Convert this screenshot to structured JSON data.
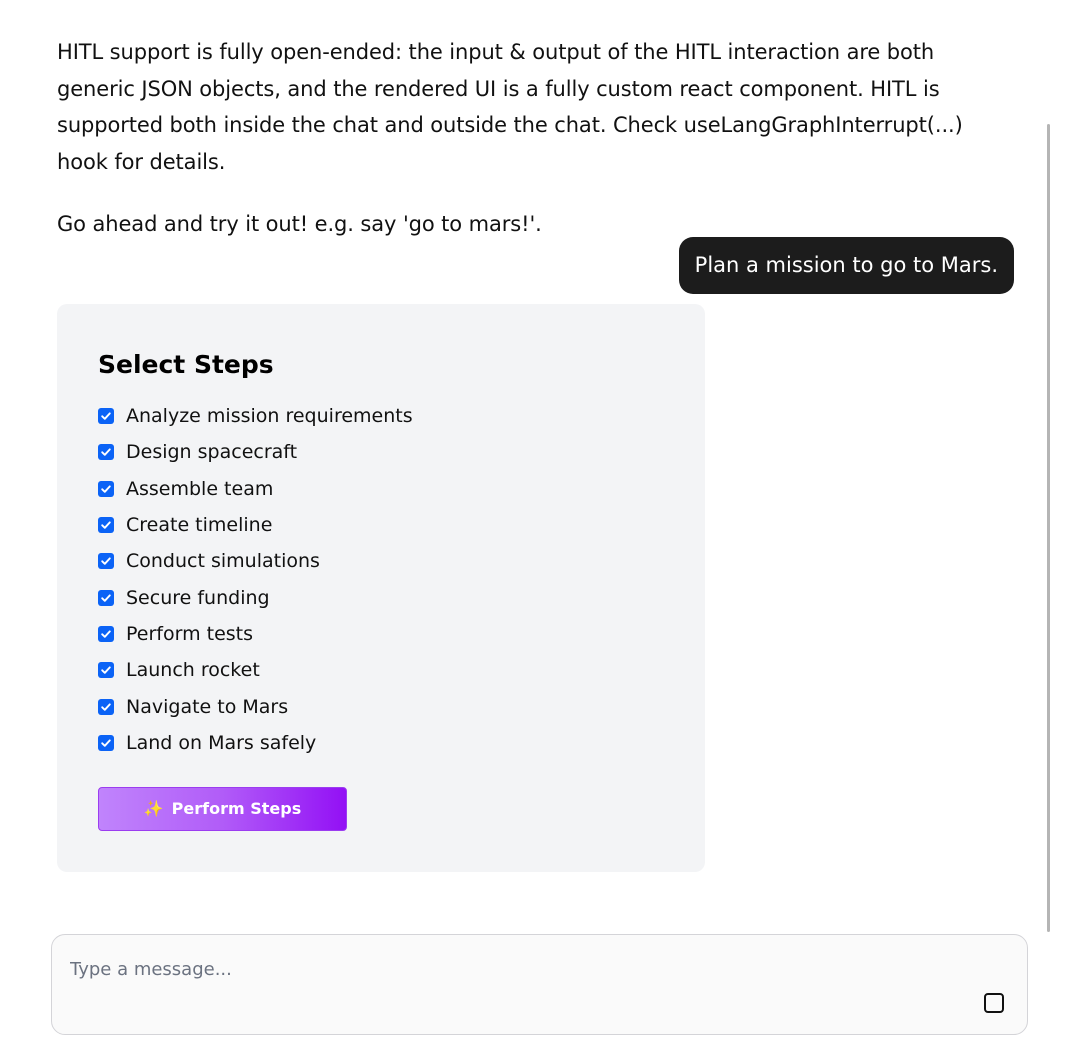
{
  "intro": {
    "paragraph_1": "HITL support is fully open-ended: the input & output of the HITL interaction are both generic JSON objects, and the rendered UI is a fully custom react component. HITL is supported both inside the chat and outside the chat. Check useLangGraphInterrupt(...) hook for details.",
    "paragraph_2": "Go ahead and try it out! e.g. say 'go to mars!'."
  },
  "user_message": "Plan a mission to go to Mars.",
  "steps_card": {
    "title": "Select Steps",
    "steps": [
      {
        "label": "Analyze mission requirements",
        "checked": true
      },
      {
        "label": "Design spacecraft",
        "checked": true
      },
      {
        "label": "Assemble team",
        "checked": true
      },
      {
        "label": "Create timeline",
        "checked": true
      },
      {
        "label": "Conduct simulations",
        "checked": true
      },
      {
        "label": "Secure funding",
        "checked": true
      },
      {
        "label": "Perform tests",
        "checked": true
      },
      {
        "label": "Launch rocket",
        "checked": true
      },
      {
        "label": "Navigate to Mars",
        "checked": true
      },
      {
        "label": "Land on Mars safely",
        "checked": true
      }
    ],
    "perform_button": {
      "icon": "sparkles-icon",
      "label": "Perform Steps"
    }
  },
  "composer": {
    "placeholder": "Type a message...",
    "value": "",
    "stop_icon": "stop-icon"
  },
  "colors": {
    "checkbox": "#0b63f6",
    "user_bubble": "#1c1c1c",
    "card_bg": "#f3f4f6",
    "button_gradient_start": "#c084fc",
    "button_gradient_end": "#9310f5"
  }
}
